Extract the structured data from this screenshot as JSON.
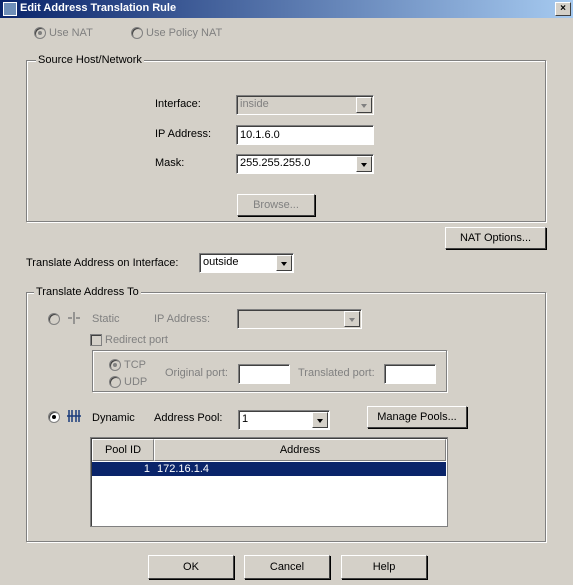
{
  "window": {
    "title": "Edit Address Translation Rule",
    "close": "×"
  },
  "mode": {
    "use_nat": "Use NAT",
    "use_policy_nat": "Use Policy NAT"
  },
  "source": {
    "group_label": "Source Host/Network",
    "interface_label": "Interface:",
    "interface_value": "inside",
    "ip_label": "IP Address:",
    "ip_value": "10.1.6.0",
    "mask_label": "Mask:",
    "mask_value": "255.255.255.0",
    "browse_label": "Browse..."
  },
  "nat_options_label": "NAT Options...",
  "translate_interface": {
    "label": "Translate Address on Interface:",
    "value": "outside"
  },
  "translate_to": {
    "group_label": "Translate Address To",
    "static_label": "Static",
    "static_ip_label": "IP Address:",
    "redirect_label": "Redirect port",
    "tcp_label": "TCP",
    "udp_label": "UDP",
    "original_port_label": "Original port:",
    "translated_port_label": "Translated port:",
    "dynamic_label": "Dynamic",
    "pool_label": "Address Pool:",
    "pool_value": "1",
    "manage_pools_label": "Manage Pools..."
  },
  "pool_table": {
    "headers": [
      "Pool ID",
      "Address"
    ],
    "rows": [
      {
        "pool_id": "1",
        "address": "172.16.1.4"
      }
    ]
  },
  "buttons": {
    "ok": "OK",
    "cancel": "Cancel",
    "help": "Help"
  }
}
